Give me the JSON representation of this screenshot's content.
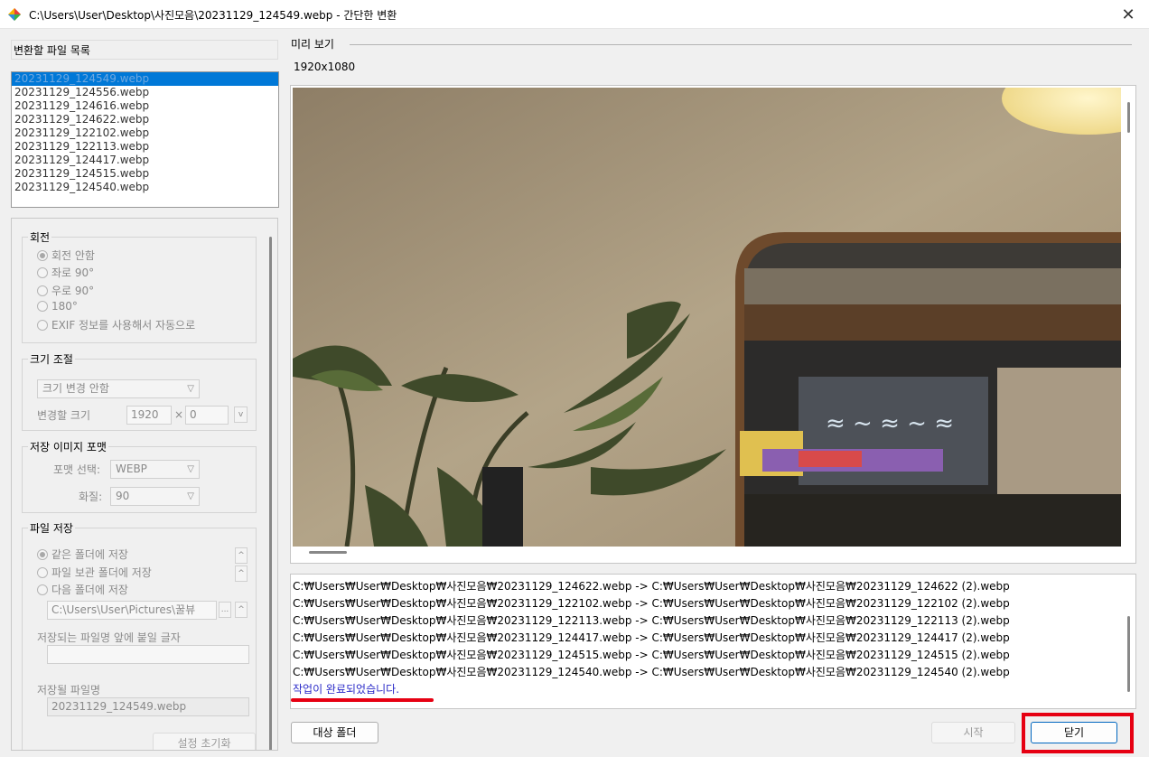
{
  "window": {
    "title": "C:\\Users\\User\\Desktop\\사진모음\\20231129_124549.webp - 간단한 변환",
    "close_symbol": "✕"
  },
  "file_list": {
    "title": "변환할 파일 목록",
    "items": [
      "20231129_124549.webp",
      "20231129_124556.webp",
      "20231129_124616.webp",
      "20231129_124622.webp",
      "20231129_122102.webp",
      "20231129_122113.webp",
      "20231129_124417.webp",
      "20231129_124515.webp",
      "20231129_124540.webp"
    ]
  },
  "rotation": {
    "title": "회전",
    "options": [
      "회전 안함",
      "좌로 90°",
      "우로 90°",
      "180°",
      "EXIF 정보를 사용해서 자동으로"
    ]
  },
  "resize": {
    "title": "크기 조절",
    "mode": "크기 변경 안함",
    "size_label": "변경할 크기",
    "width": "1920",
    "height": "0",
    "x_symbol": "×",
    "v_label": "v"
  },
  "format": {
    "title": "저장 이미지 포맷",
    "format_label": "포맷 선택:",
    "format_value": "WEBP",
    "quality_label": "화질:",
    "quality_value": "90"
  },
  "save": {
    "title": "파일 저장",
    "options": [
      "같은 폴더에 저장",
      "파일 보관 폴더에 저장",
      "다음 폴더에 저장"
    ],
    "folder_path": "C:\\Users\\User\\Pictures\\꿀뷰",
    "browse_label": "...",
    "prefix_label": "저장되는 파일명 앞에 붙일 글자",
    "prefix_value": "",
    "filename_label": "저장될 파일명",
    "filename_value": "20231129_124549.webp",
    "reset_label": "설정 초기화"
  },
  "preview": {
    "label": "미리 보기",
    "dimensions": "1920x1080"
  },
  "log": {
    "lines": [
      "C:₩Users₩User₩Desktop₩사진모음₩20231129_124622.webp -> C:₩Users₩User₩Desktop₩사진모음₩20231129_124622 (2).webp",
      "C:₩Users₩User₩Desktop₩사진모음₩20231129_122102.webp -> C:₩Users₩User₩Desktop₩사진모음₩20231129_122102 (2).webp",
      "C:₩Users₩User₩Desktop₩사진모음₩20231129_122113.webp -> C:₩Users₩User₩Desktop₩사진모음₩20231129_122113 (2).webp",
      "C:₩Users₩User₩Desktop₩사진모음₩20231129_124417.webp -> C:₩Users₩User₩Desktop₩사진모음₩20231129_124417 (2).webp",
      "C:₩Users₩User₩Desktop₩사진모음₩20231129_124515.webp -> C:₩Users₩User₩Desktop₩사진모음₩20231129_124515 (2).webp",
      "C:₩Users₩User₩Desktop₩사진모음₩20231129_124540.webp -> C:₩Users₩User₩Desktop₩사진모음₩20231129_124540 (2).webp"
    ],
    "done_message": "작업이 완료되었습니다."
  },
  "buttons": {
    "target_folder": "대상 폴더",
    "start": "시작",
    "close": "닫기"
  },
  "colors": {
    "selection": "#0078d7",
    "highlight_red": "#e60012",
    "done_text": "#2a2ac8"
  }
}
